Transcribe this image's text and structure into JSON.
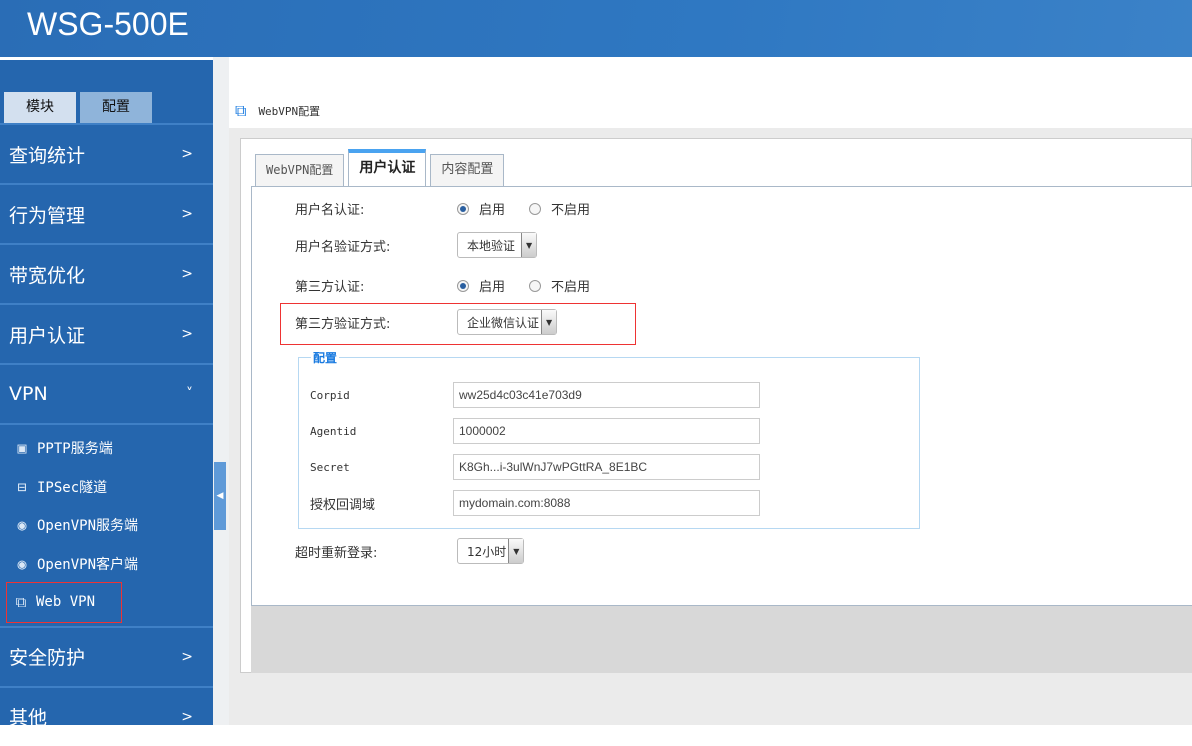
{
  "header": {
    "title": "WSG-500E"
  },
  "sidebar": {
    "mode_tabs": [
      "模块",
      "配置"
    ],
    "menu": [
      {
        "label": "查询统计"
      },
      {
        "label": "行为管理"
      },
      {
        "label": "带宽优化"
      },
      {
        "label": "用户认证"
      },
      {
        "label": "VPN",
        "expanded": true
      }
    ],
    "vpn_sub": [
      {
        "label": "PPTP服务端"
      },
      {
        "label": "IPSec隧道"
      },
      {
        "label": "OpenVPN服务端"
      },
      {
        "label": "OpenVPN客户端"
      },
      {
        "label": "Web VPN",
        "selected": true
      }
    ],
    "menu_after": [
      {
        "label": "安全防护"
      },
      {
        "label": "其他"
      }
    ],
    "chevron_right": ">",
    "chevron_down": "˅"
  },
  "breadcrumb": "WebVPN配置",
  "tabs": [
    {
      "label": "WebVPN配置"
    },
    {
      "label": "用户认证",
      "active": true
    },
    {
      "label": "内容配置"
    }
  ],
  "form": {
    "username_auth": {
      "label": "用户名认证:",
      "options": [
        "启用",
        "不启用"
      ],
      "selected": "启用"
    },
    "username_method": {
      "label": "用户名验证方式:",
      "value": "本地验证"
    },
    "third_auth": {
      "label": "第三方认证:",
      "options": [
        "启用",
        "不启用"
      ],
      "selected": "启用"
    },
    "third_method": {
      "label": "第三方验证方式:",
      "value": "企业微信认证"
    },
    "config": {
      "legend": "配置",
      "fields": [
        {
          "label": "Corpid",
          "value": "ww25d4c03c41e703d9"
        },
        {
          "label": "Agentid",
          "value": "1000002"
        },
        {
          "label": "Secret",
          "value": "K8Gh...i-3ulWnJ7wPGttRA_8E1BC"
        },
        {
          "label": "授权回调域",
          "value": "mydomain.com:8088"
        }
      ]
    },
    "relogin": {
      "label": "超时重新登录:",
      "value": "12小时"
    }
  },
  "colors": {
    "header": "#2a6db6",
    "sidebar": "#2566ae",
    "highlight": "#ee3333",
    "accent": "#1a7be0"
  }
}
